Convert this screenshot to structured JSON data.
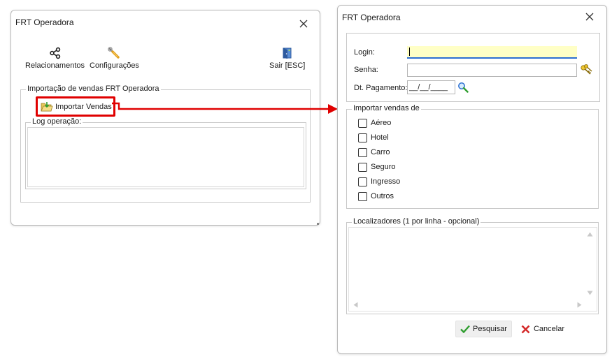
{
  "left_window": {
    "title": "FRT Operadora",
    "toolbar": {
      "relacionamentos": "Relacionamentos",
      "configuracoes": "Configurações",
      "sair": "Sair [ESC]"
    },
    "import_group_legend": "Importação de vendas FRT Operadora",
    "import_button_label": "Importar Vendas",
    "log_legend": "Log operação:"
  },
  "right_window": {
    "title": "FRT Operadora",
    "login_label": "Login:",
    "login_value": "",
    "senha_label": "Senha:",
    "senha_value": "",
    "dt_pagamento_label": "Dt. Pagamento:",
    "dt_pagamento_value": "__/__/____",
    "importar_legend": "Importar vendas de",
    "options": [
      "Aéreo",
      "Hotel",
      "Carro",
      "Seguro",
      "Ingresso",
      "Outros"
    ],
    "localizadores_legend": "Localizadores (1 por linha - opcional)",
    "pesquisar_label": "Pesquisar",
    "cancelar_label": "Cancelar"
  },
  "colors": {
    "highlight": "#e00000",
    "login_bg": "#ffffc6",
    "focus_underline": "#2d6fd1",
    "ok_green": "#2f9e2f",
    "cancel_red": "#d42a2a"
  },
  "icons": [
    "share-icon",
    "wrench-icon",
    "exit-door-icon",
    "folder-import-icon",
    "close-icon",
    "keys-icon",
    "magnifier-calendar-icon",
    "checkmark-icon",
    "x-cancel-icon"
  ]
}
